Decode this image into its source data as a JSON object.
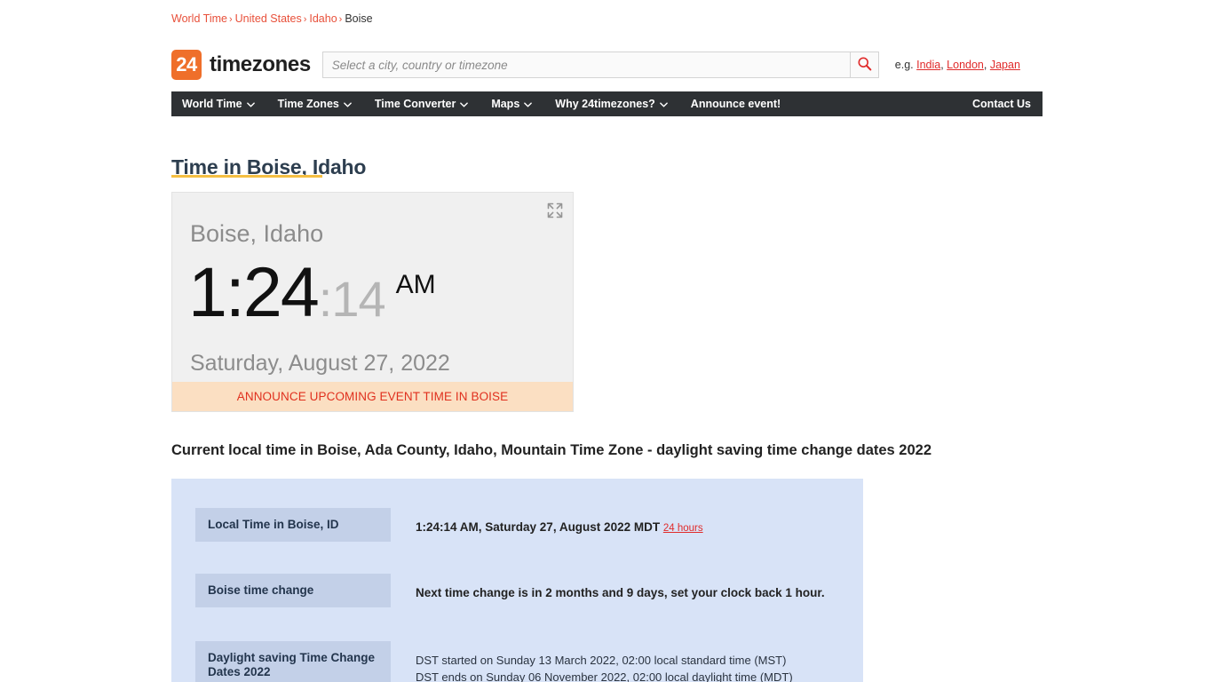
{
  "breadcrumb": {
    "items": [
      {
        "label": "World Time",
        "link": true
      },
      {
        "label": "United States",
        "link": true
      },
      {
        "label": "Idaho",
        "link": true
      },
      {
        "label": "Boise",
        "link": false
      }
    ],
    "separator": "›"
  },
  "header": {
    "logo_badge": "24",
    "logo_text": "timezones",
    "search": {
      "placeholder": "Select a city, country or timezone",
      "value": "",
      "icon": "search-icon"
    },
    "examples_prefix": "e.g.",
    "examples": [
      "India",
      "London",
      "Japan"
    ]
  },
  "nav": {
    "items": [
      {
        "label": "World Time",
        "caret": true
      },
      {
        "label": "Time Zones",
        "caret": true
      },
      {
        "label": "Time Converter",
        "caret": true
      },
      {
        "label": "Maps",
        "caret": true
      },
      {
        "label": "Why 24timezones?",
        "caret": true
      },
      {
        "label": "Announce event!",
        "caret": false
      }
    ],
    "right_item": "Contact Us"
  },
  "main": {
    "page_title": "Time in Boise, Idaho",
    "clock": {
      "city": "Boise, Idaho",
      "hours_minutes": "1:24",
      "seconds": ":14",
      "ampm": "AM",
      "date": "Saturday, August 27, 2022",
      "announce_label": "ANNOUNCE UPCOMING EVENT TIME IN BOISE",
      "expand_icon": "expand-icon"
    },
    "sub_heading": "Current local time in Boise, Ada County, Idaho, Mountain Time Zone - daylight saving time change dates 2022",
    "info_rows": [
      {
        "label": "Local Time in Boise, ID",
        "value": "1:24:14 AM, Saturday 27, August 2022 MDT",
        "link": "24 hours"
      },
      {
        "label": "Boise time change",
        "value": "Next time change is in 2 months and 9 days, set your clock back 1 hour."
      },
      {
        "label": "Daylight saving Time Change Dates 2022",
        "line1": "DST started on Sunday 13 March 2022, 02:00 local standard time (MST)",
        "line2": "DST ends on Sunday 06 November 2022, 02:00 local daylight time (MDT)"
      }
    ]
  },
  "colors": {
    "brand_orange": "#ef6f2a",
    "link_red": "#e02b2b",
    "nav_dark": "#2e3134",
    "panel_blue": "#d8e3f7",
    "label_blue": "#c3d0e8",
    "accent_yellow": "#f5bf42",
    "announce_bg": "#fbdfc2"
  }
}
